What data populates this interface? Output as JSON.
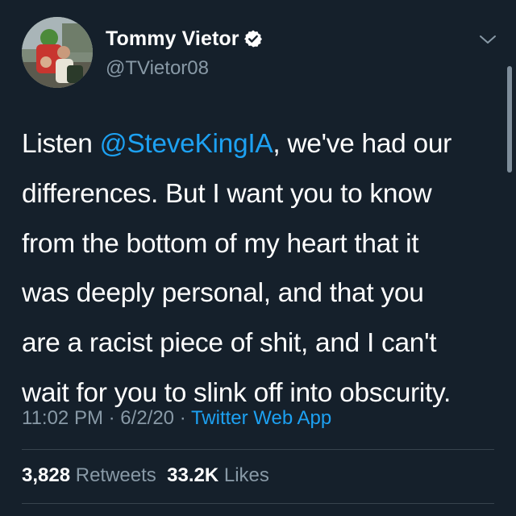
{
  "tweet": {
    "display_name": "Tommy Vietor",
    "handle": "@TVietor08",
    "verified": true,
    "text_lines": [
      {
        "before": "Listen ",
        "mention": "@SteveKingIA",
        "after": ", we've had our"
      },
      {
        "text": "differences. But I want you to know"
      },
      {
        "text": "from the bottom of my heart that it"
      },
      {
        "text": "was deeply personal, and that you"
      },
      {
        "text": "are a racist piece of shit, and I can't"
      },
      {
        "text": "wait for you to slink off into obscurity."
      }
    ],
    "time": "11:02 PM",
    "date": "6/2/20",
    "separator": "·",
    "source": "Twitter Web App",
    "retweets_count": "3,828",
    "retweets_label": "Retweets",
    "likes_count": "33.2K",
    "likes_label": "Likes"
  },
  "icons": {
    "verified": "verified-badge-icon",
    "menu": "chevron-down-icon"
  },
  "colors": {
    "background": "#15202b",
    "text": "#ffffff",
    "secondary": "#8899a6",
    "accent": "#1da1f2",
    "divider": "#38444d"
  }
}
